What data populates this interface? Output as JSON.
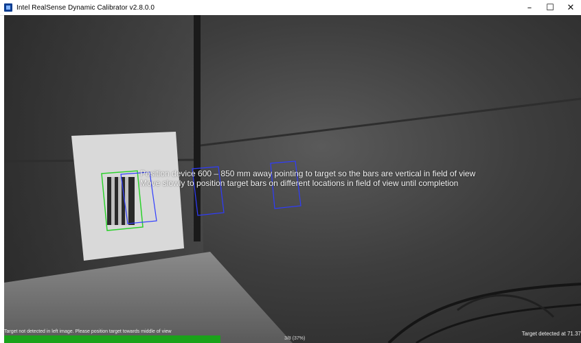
{
  "window": {
    "title": "Intel RealSense Dynamic Calibrator v2.8.0.0",
    "icon": "realsense-app-icon",
    "controls": {
      "minimize": "–",
      "maximize": "☐",
      "close": "✕"
    }
  },
  "overlay": {
    "instruction_line1": "Position device 600 – 850 mm away pointing to target so the bars are vertical in field of view",
    "instruction_line2": "Move slowly to position target bars on different locations in field of view until completion"
  },
  "status": {
    "left_message": "Target not detected in left image. Please position target towards middle of view",
    "right_message": "Target detected at 71.37",
    "progress_text": "3/8 (37%)",
    "progress_fraction": 0.375,
    "progress_color": "#1aa21a"
  },
  "colors": {
    "detected_box": "#2bd12b",
    "guide_box": "#2f3cff"
  }
}
